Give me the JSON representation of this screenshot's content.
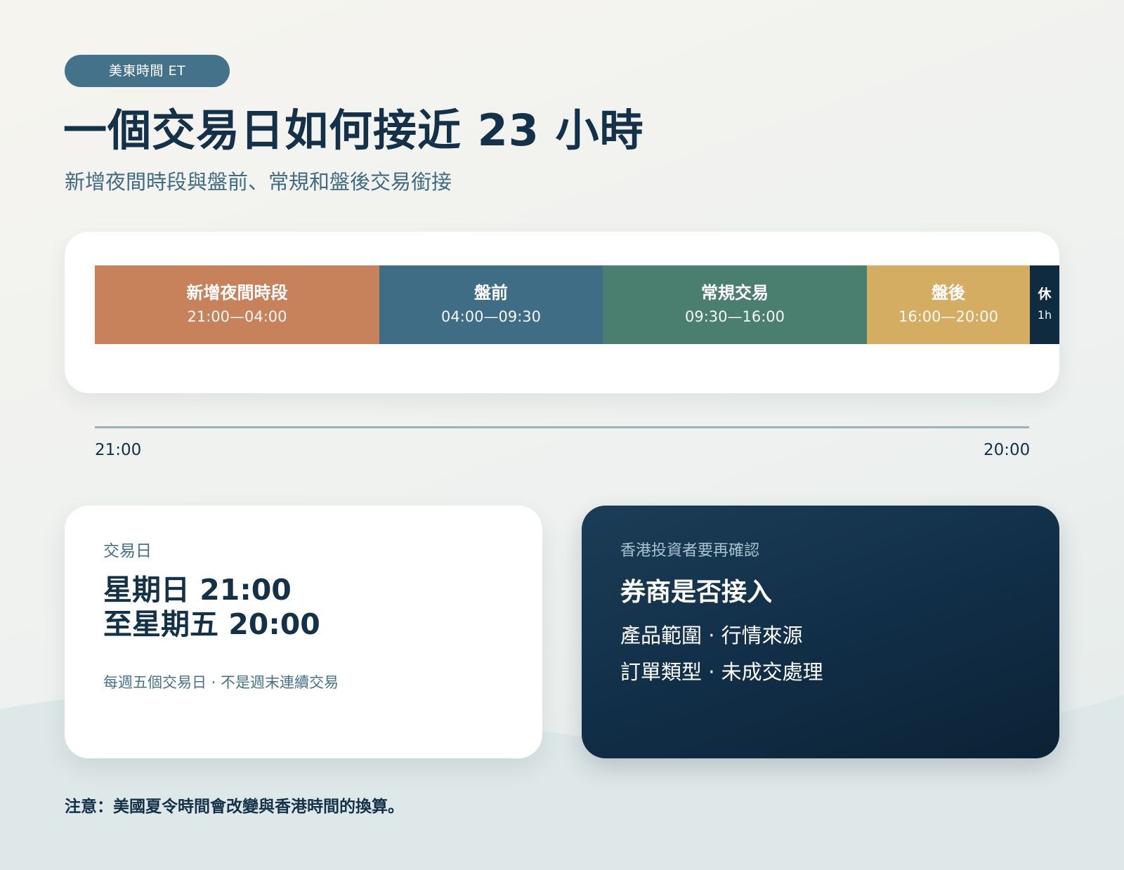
{
  "badge": "美東時間 ET",
  "title": "一個交易日如何接近 23 小時",
  "subtitle": "新增夜間時段與盤前、常規和盤後交易銜接",
  "sessions": [
    {
      "label": "新增夜間時段",
      "time": "21:00—04:00",
      "color": "#c8825b"
    },
    {
      "label": "盤前",
      "time": "04:00—09:30",
      "color": "#3f6d86"
    },
    {
      "label": "常規交易",
      "time": "09:30—16:00",
      "color": "#4a7f6f"
    },
    {
      "label": "盤後",
      "time": "16:00—20:00",
      "color": "#d4ad63"
    },
    {
      "label": "休",
      "time": "1h",
      "color": "#0f2b3f"
    }
  ],
  "axis": {
    "start": "21:00",
    "end": "20:00"
  },
  "trading_day_card": {
    "kicker": "交易日",
    "line1": "星期日 21:00",
    "line2": "至星期五 20:00",
    "note": "每週五個交易日 · 不是週末連續交易"
  },
  "hk_card": {
    "kicker": "香港投資者要再確認",
    "heading": "券商是否接入",
    "line1": "產品範圍 · 行情來源",
    "line2": "訂單類型 · 未成交處理"
  },
  "footer": "注意：美國夏令時間會改變與香港時間的換算。"
}
